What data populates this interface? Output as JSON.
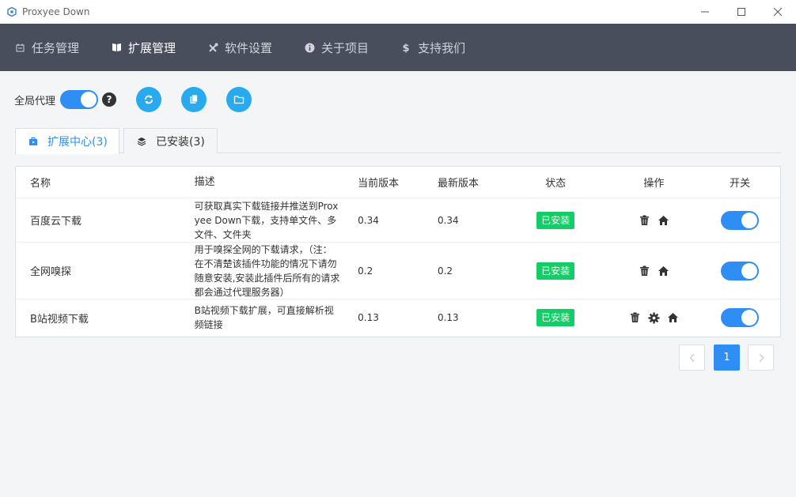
{
  "window": {
    "title": "Proxyee Down"
  },
  "nav": {
    "items": [
      {
        "label": "任务管理",
        "icon": "calendar-icon"
      },
      {
        "label": "扩展管理",
        "icon": "book-icon"
      },
      {
        "label": "软件设置",
        "icon": "tools-icon"
      },
      {
        "label": "关于项目",
        "icon": "info-icon"
      },
      {
        "label": "支持我们",
        "icon": "dollar-icon"
      }
    ],
    "active_index": 1
  },
  "toolbar": {
    "proxy_label": "全局代理",
    "proxy_enabled": true,
    "help": "?"
  },
  "tabs": [
    {
      "label": "扩展中心(3)",
      "icon": "store-icon"
    },
    {
      "label": "已安装(3)",
      "icon": "layers-icon"
    }
  ],
  "table": {
    "headers": {
      "name": "名称",
      "desc": "描述",
      "current": "当前版本",
      "latest": "最新版本",
      "state": "状态",
      "ops": "操作",
      "switch": "开关"
    },
    "rows": [
      {
        "name": "百度云下载",
        "desc": "可获取真实下载链接并推送到Proxyee Down下载，支持单文件、多文件、文件夹",
        "current": "0.34",
        "latest": "0.34",
        "state": "已安装",
        "enabled": true
      },
      {
        "name": "全网嗅探",
        "desc": "用于嗅探全网的下载请求，（注：在不清楚该插件功能的情况下请勿随意安装,安装此插件后所有的请求都会通过代理服务器）",
        "current": "0.2",
        "latest": "0.2",
        "state": "已安装",
        "enabled": true
      },
      {
        "name": "B站视频下载",
        "desc": "B站视频下载扩展，可直接解析视频链接",
        "current": "0.13",
        "latest": "0.13",
        "state": "已安装",
        "enabled": true
      }
    ]
  },
  "pagination": {
    "current_page": "1"
  },
  "colors": {
    "accent": "#2f8ef3",
    "navbar": "#484e5c",
    "success": "#13ce66",
    "circle_button": "#29aaef"
  }
}
